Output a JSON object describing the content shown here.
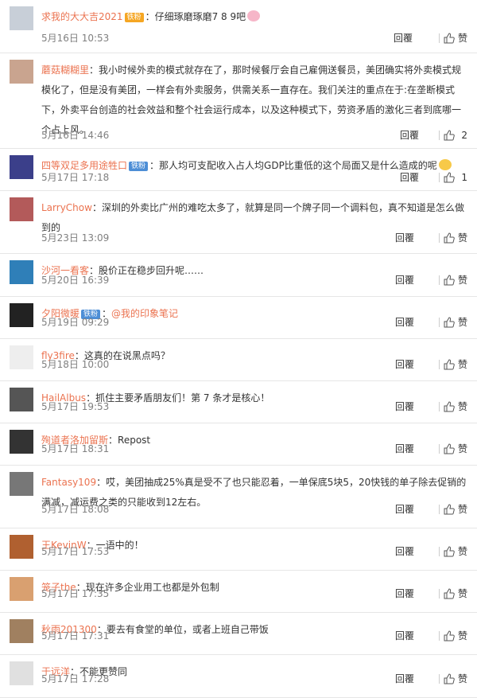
{
  "comments": [
    {
      "name": "求我的大大吉2021",
      "badge": "铁粉",
      "badge_color": "yellow",
      "text": "：仔细琢磨琢磨7 8 9吧",
      "emoji": "pig",
      "date": "5月16日 10:53",
      "reply": "回覆",
      "like": "赞"
    },
    {
      "name": "蘑菇糊糊里",
      "badge": "",
      "text": "：我小时候外卖的模式就存在了，那时候餐厅会自己雇佣送餐员，美团确实将外卖模式规模化了，但是没有美团，一样会有外卖服务，供需关系一直存在。我们关注的重点在于:在垄断模式下，外卖平台创造的社会效益和整个社会运行成本，以及这种模式下，劳资矛盾的激化三者到底哪一个占上风。",
      "date": "5月16日 14:46",
      "reply": "回覆",
      "like": "2"
    },
    {
      "name": "四等双足多用途牲口",
      "badge": "铁粉",
      "badge_color": "blue",
      "text": "：那人均可支配收入占人均GDP比重低的这个局面又是什么造成的呢",
      "emoji": "smile",
      "date": "5月17日 17:18",
      "reply": "回覆",
      "like": "1"
    },
    {
      "name": "LarryChow",
      "badge": "",
      "text": "：深圳的外卖比广州的难吃太多了，就算是同一个牌子同一个调料包，真不知道是怎么做到的",
      "date": "5月23日 13:09",
      "reply": "回覆",
      "like": "赞"
    },
    {
      "name": "沙河一看客",
      "badge": "",
      "text": "：股价正在稳步回升呢……",
      "date": "5月20日 16:39",
      "reply": "回覆",
      "like": "赞"
    },
    {
      "name": "夕阳微暖",
      "badge": "铁粉",
      "badge_color": "blue",
      "text": "：",
      "mention": "@我的印象笔记",
      "date": "5月19日 09:29",
      "reply": "回覆",
      "like": "赞"
    },
    {
      "name": "fly3fire",
      "badge": "",
      "text": "：这真的在说黑点吗？",
      "date": "5月18日 10:00",
      "reply": "回覆",
      "like": "赞"
    },
    {
      "name": "HailAlbus",
      "badge": "",
      "text": "：抓住主要矛盾朋友们！第 7 条才是核心！",
      "date": "5月17日 19:53",
      "reply": "回覆",
      "like": "赞"
    },
    {
      "name": "殉道者洛加留斯",
      "badge": "",
      "text": "：Repost",
      "date": "5月17日 18:31",
      "reply": "回覆",
      "like": "赞"
    },
    {
      "name": "Fantasy109",
      "badge": "",
      "text": "：哎，美团抽成25%真是受不了也只能忍着，一单保底5块5，20快钱的单子除去促销的满减，减运费之类的只能收到12左右。",
      "date": "5月17日 18:08",
      "reply": "回覆",
      "like": "赞"
    },
    {
      "name": "王KevinW",
      "badge": "",
      "text": "：一语中的！",
      "date": "5月17日 17:53",
      "reply": "回覆",
      "like": "赞"
    },
    {
      "name": "笼子the",
      "badge": "",
      "text": "：现在许多企业用工也都是外包制",
      "date": "5月17日 17:35",
      "reply": "回覆",
      "like": "赞"
    },
    {
      "name": "秋雨201300",
      "badge": "",
      "text": "：要去有食堂的单位，或者上班自己带饭",
      "date": "5月17日 17:31",
      "reply": "回覆",
      "like": "赞"
    },
    {
      "name": "于远洋",
      "badge": "",
      "text": "：不能更赞同",
      "date": "5月17日 17:28",
      "reply": "回覆",
      "like": "赞"
    }
  ],
  "colors": {
    "name": "#eb7350",
    "text": "#333333",
    "date": "#808080",
    "badge_blue": "#4d8ed6",
    "badge_yellow": "#f5a623",
    "divider": "#e6e6e6"
  }
}
